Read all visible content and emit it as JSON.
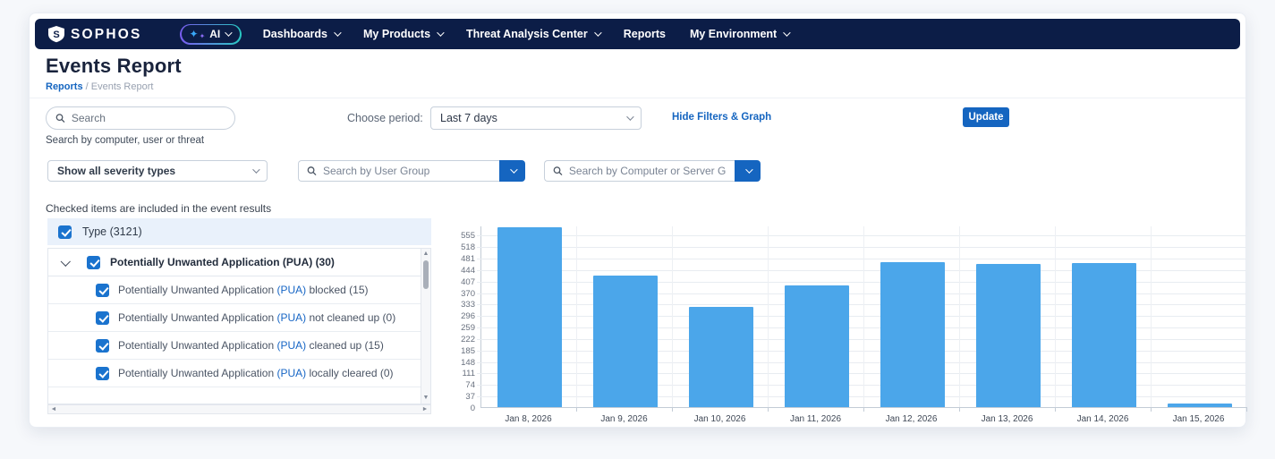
{
  "colors": {
    "navy": "#0c1d47",
    "accent": "#1565c0",
    "bar_blue": "#4ba6ea",
    "checkbox_blue": "#1a73ce",
    "row_highlight": "#e9f1fb"
  },
  "nav": {
    "brand": "SOPHOS",
    "brand_initial": "S",
    "ai_label": "AI",
    "items": [
      {
        "label": "Dashboards",
        "chevron": true
      },
      {
        "label": "My Products",
        "chevron": true
      },
      {
        "label": "Threat Analysis Center",
        "chevron": true
      },
      {
        "label": "Reports",
        "chevron": false
      },
      {
        "label": "My Environment",
        "chevron": true
      }
    ]
  },
  "header": {
    "title": "Events Report",
    "breadcrumb_parent": "Reports",
    "breadcrumb_sep": "/",
    "breadcrumb_current": "Events Report"
  },
  "filters": {
    "search_placeholder": "Search",
    "search_helper": "Search by computer, user or threat",
    "period_label": "Choose period:",
    "period_value": "Last 7 days",
    "hide_link": "Hide Filters & Graph",
    "update_label": "Update",
    "severity_value": "Show all severity types",
    "user_group_placeholder": "Search by User Group",
    "computer_group_placeholder": "Search by Computer or Server Group"
  },
  "tree": {
    "note": "Checked items are included in the event results",
    "root_label": "Type (3121)",
    "group_label": "Potentially Unwanted Application (PUA) (30)",
    "items": [
      {
        "pre": "Potentially Unwanted Application ",
        "link": "(PUA)",
        "post": " blocked (15)"
      },
      {
        "pre": "Potentially Unwanted Application ",
        "link": "(PUA)",
        "post": " not cleaned up (0)"
      },
      {
        "pre": "Potentially Unwanted Application ",
        "link": "(PUA)",
        "post": " cleaned up (15)"
      },
      {
        "pre": "Potentially Unwanted Application ",
        "link": "(PUA)",
        "post": " locally cleared (0)"
      }
    ]
  },
  "chart_data": {
    "type": "bar",
    "title": "",
    "xlabel": "",
    "ylabel": "",
    "categories": [
      "Jan 8, 2026",
      "Jan 9, 2026",
      "Jan 10, 2026",
      "Jan 11, 2026",
      "Jan 12, 2026",
      "Jan 13, 2026",
      "Jan 14, 2026",
      "Jan 15, 2026"
    ],
    "values": [
      580,
      423,
      322,
      393,
      467,
      462,
      463,
      12
    ],
    "yticks": [
      0,
      37,
      74,
      111,
      148,
      185,
      222,
      259,
      296,
      333,
      370,
      407,
      444,
      481,
      518,
      555
    ],
    "ylim": [
      0,
      585
    ],
    "grid": true,
    "legend": "none",
    "bar_color": "#4ba6ea"
  }
}
